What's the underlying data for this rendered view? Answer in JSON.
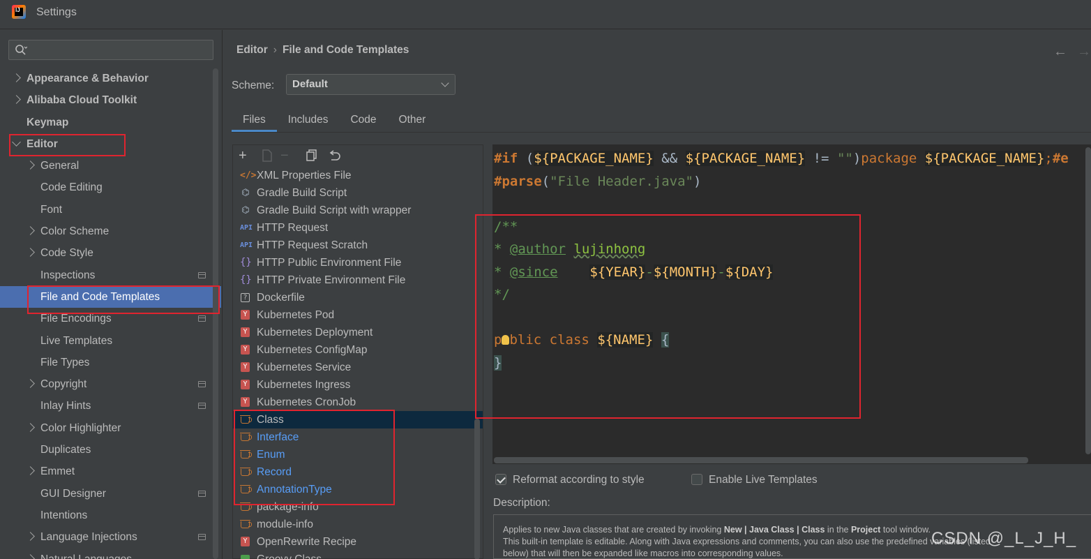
{
  "window": {
    "title": "Settings"
  },
  "sidebar": {
    "items": [
      {
        "label": "Appearance & Behavior",
        "level": 0,
        "chevron": "right"
      },
      {
        "label": "Alibaba Cloud Toolkit",
        "level": 0,
        "chevron": "right"
      },
      {
        "label": "Keymap",
        "level": 0,
        "chevron": "none"
      },
      {
        "label": "Editor",
        "level": 0,
        "chevron": "down"
      },
      {
        "label": "General",
        "level": 1,
        "chevron": "right"
      },
      {
        "label": "Code Editing",
        "level": 1,
        "chevron": "none"
      },
      {
        "label": "Font",
        "level": 1,
        "chevron": "none"
      },
      {
        "label": "Color Scheme",
        "level": 1,
        "chevron": "right"
      },
      {
        "label": "Code Style",
        "level": 1,
        "chevron": "right"
      },
      {
        "label": "Inspections",
        "level": 1,
        "chevron": "none",
        "project": true
      },
      {
        "label": "File and Code Templates",
        "level": 1,
        "chevron": "none",
        "selected": true
      },
      {
        "label": "File Encodings",
        "level": 1,
        "chevron": "none",
        "project": true
      },
      {
        "label": "Live Templates",
        "level": 1,
        "chevron": "none"
      },
      {
        "label": "File Types",
        "level": 1,
        "chevron": "none"
      },
      {
        "label": "Copyright",
        "level": 1,
        "chevron": "right",
        "project": true
      },
      {
        "label": "Inlay Hints",
        "level": 1,
        "chevron": "none",
        "project": true
      },
      {
        "label": "Color Highlighter",
        "level": 1,
        "chevron": "right"
      },
      {
        "label": "Duplicates",
        "level": 1,
        "chevron": "none"
      },
      {
        "label": "Emmet",
        "level": 1,
        "chevron": "right"
      },
      {
        "label": "GUI Designer",
        "level": 1,
        "chevron": "none",
        "project": true
      },
      {
        "label": "Intentions",
        "level": 1,
        "chevron": "none"
      },
      {
        "label": "Language Injections",
        "level": 1,
        "chevron": "right",
        "project": true
      },
      {
        "label": "Natural Languages",
        "level": 1,
        "chevron": "right"
      }
    ]
  },
  "breadcrumb": {
    "parent": "Editor",
    "separator": "›",
    "current": "File and Code Templates"
  },
  "scheme": {
    "label": "Scheme:",
    "value": "Default"
  },
  "tabs": {
    "files": "Files",
    "includes": "Includes",
    "code": "Code",
    "other": "Other"
  },
  "templates": [
    {
      "label": "XML Properties File",
      "icon": "xml-icon"
    },
    {
      "label": "Gradle Build Script",
      "icon": "gradle-icon"
    },
    {
      "label": "Gradle Build Script with wrapper",
      "icon": "gradle-icon"
    },
    {
      "label": "HTTP Request",
      "icon": "api-icon"
    },
    {
      "label": "HTTP Request Scratch",
      "icon": "api-icon"
    },
    {
      "label": "HTTP Public Environment File",
      "icon": "braces-icon"
    },
    {
      "label": "HTTP Private Environment File",
      "icon": "braces-icon"
    },
    {
      "label": "Dockerfile",
      "icon": "dockerfile-icon"
    },
    {
      "label": "Kubernetes Pod",
      "icon": "kubernetes-icon"
    },
    {
      "label": "Kubernetes Deployment",
      "icon": "kubernetes-icon"
    },
    {
      "label": "Kubernetes ConfigMap",
      "icon": "kubernetes-icon"
    },
    {
      "label": "Kubernetes Service",
      "icon": "kubernetes-icon"
    },
    {
      "label": "Kubernetes Ingress",
      "icon": "kubernetes-icon"
    },
    {
      "label": "Kubernetes CronJob",
      "icon": "kubernetes-icon"
    },
    {
      "label": "Class",
      "icon": "java-icon",
      "selected": true
    },
    {
      "label": "Interface",
      "icon": "java-icon",
      "blue": true
    },
    {
      "label": "Enum",
      "icon": "java-icon",
      "blue": true
    },
    {
      "label": "Record",
      "icon": "java-icon",
      "blue": true
    },
    {
      "label": "AnnotationType",
      "icon": "java-icon",
      "blue": true
    },
    {
      "label": "package-info",
      "icon": "java-icon"
    },
    {
      "label": "module-info",
      "icon": "java-icon"
    },
    {
      "label": "OpenRewrite Recipe",
      "icon": "kubernetes-icon"
    },
    {
      "label": "Groovy Class",
      "icon": "groovy-icon"
    }
  ],
  "editor": {
    "line1": {
      "if": "#if",
      "open": " (",
      "var1": "${PACKAGE_NAME}",
      "and": " && ",
      "var2": "${PACKAGE_NAME}",
      "neq": " != ",
      "empty": "\"\"",
      "close": ")",
      "pkg": "package ",
      "var3": "${PACKAGE_NAME}",
      "semi": ";",
      "end": "#e"
    },
    "line2": {
      "parse": "#parse",
      "open": "(",
      "arg": "\"File Header.java\"",
      "close": ")"
    },
    "doc_open": "/**",
    "author_star": "* ",
    "author_tag": "@author",
    "author_name": "lujinhong",
    "since_star": "* ",
    "since_tag": "@since",
    "since_gap": "   ",
    "year": "${YEAR}",
    "dash": "-",
    "month": "${MONTH}",
    "day": "${DAY}",
    "doc_close": "*/",
    "class_p": "p",
    "class_rest": "blic class ",
    "class_name": "${NAME}",
    "class_open": "{",
    "class_close": "}"
  },
  "options": {
    "reformat": {
      "label": "Reformat according to style",
      "checked": true
    },
    "live": {
      "label": "Enable Live Templates",
      "checked": false
    }
  },
  "description": {
    "label": "Description:",
    "t1": "Applies to new Java classes that are created by invoking ",
    "b1": "New | Java Class | Class",
    "t2": " in the ",
    "b2": "Project",
    "t3": " tool window.",
    "line2": "This built-in template is editable. Along with Java expressions and comments, you can also use the predefined variables (listed",
    "line3": "below) that will then be expanded like macros into corresponding values."
  },
  "watermark": "CSDN @_L_J_H_",
  "colors": {
    "selection": "#4b6eaf",
    "annotation_red": "#e0242f",
    "link_blue": "#589df6"
  }
}
